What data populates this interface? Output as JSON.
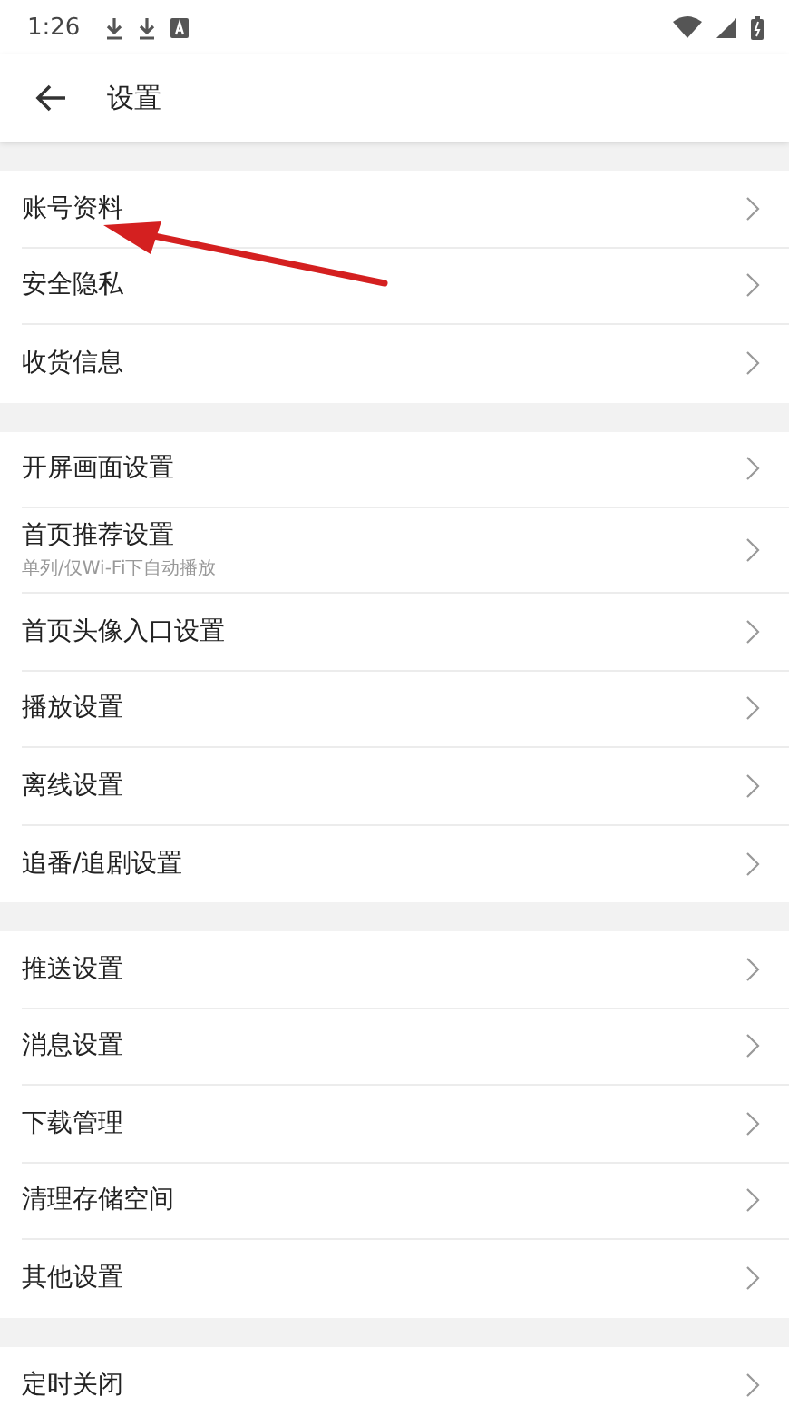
{
  "status_bar": {
    "time": "1:26"
  },
  "header": {
    "title": "设置"
  },
  "groups": [
    {
      "items": [
        {
          "label": "账号资料"
        },
        {
          "label": "安全隐私"
        },
        {
          "label": "收货信息"
        }
      ]
    },
    {
      "items": [
        {
          "label": "开屏画面设置"
        },
        {
          "label": "首页推荐设置",
          "subtitle": "单列/仅Wi-Fi下自动播放"
        },
        {
          "label": "首页头像入口设置"
        },
        {
          "label": "播放设置"
        },
        {
          "label": "离线设置"
        },
        {
          "label": "追番/追剧设置"
        }
      ]
    },
    {
      "items": [
        {
          "label": "推送设置"
        },
        {
          "label": "消息设置"
        },
        {
          "label": "下载管理"
        },
        {
          "label": "清理存储空间"
        },
        {
          "label": "其他设置"
        }
      ]
    },
    {
      "items": [
        {
          "label": "定时关闭"
        }
      ]
    }
  ],
  "annotation": {
    "kind": "arrow"
  }
}
